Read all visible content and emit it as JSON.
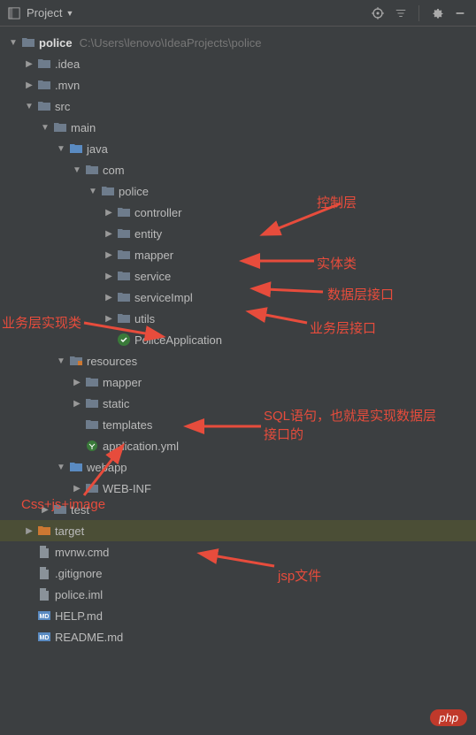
{
  "toolbar": {
    "title": "Project"
  },
  "tree": {
    "root": {
      "name": "police",
      "path": "C:\\Users\\lenovo\\IdeaProjects\\police"
    },
    "nodes": {
      "idea": ".idea",
      "mvn": ".mvn",
      "src": "src",
      "main": "main",
      "java": "java",
      "com": "com",
      "police": "police",
      "controller": "controller",
      "entity": "entity",
      "mapper": "mapper",
      "service": "service",
      "serviceImpl": "serviceImpl",
      "utils": "utils",
      "policeApp": "PoliceApplication",
      "resources": "resources",
      "res_mapper": "mapper",
      "static": "static",
      "templates": "templates",
      "appyml": "application.yml",
      "webapp": "webapp",
      "webinf": "WEB-INF",
      "test": "test",
      "target": "target",
      "mvnwcmd": "mvnw.cmd",
      "gitignore": ".gitignore",
      "policeiml": "police.iml",
      "helpmd": "HELP.md",
      "readme": "README.md"
    }
  },
  "annotations": {
    "controller": "控制层",
    "entity": "实体类",
    "mapper": "数据层接口",
    "service": "业务层接口",
    "serviceImpl": "业务层实现类",
    "resMapper": "SQL语句，也就是实现数据层接口的",
    "static": "Css+js+image",
    "webinf": "jsp文件"
  },
  "watermark": "php"
}
